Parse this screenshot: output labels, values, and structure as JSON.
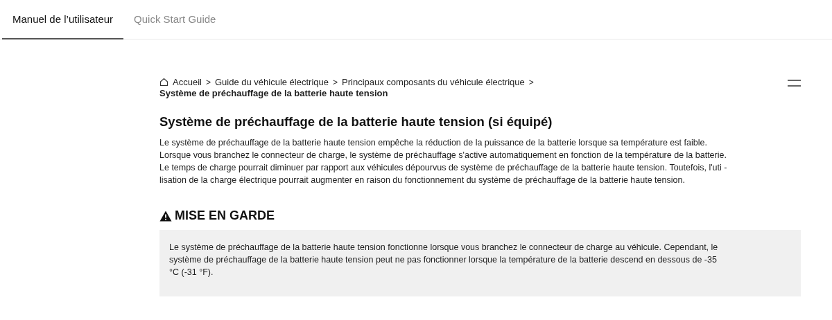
{
  "tabs": [
    {
      "label": "Manuel de l’utilisateur",
      "selected": true
    },
    {
      "label": "Quick Start Guide",
      "selected": false
    }
  ],
  "breadcrumb": {
    "items": [
      "Accueil",
      "Guide du véhicule électrique",
      "Principaux composants du véhicule électrique"
    ],
    "separator": ">",
    "current": "Système de préchauffage de la batterie haute tension"
  },
  "article": {
    "title": "Système de préchauffage de la batterie haute tension (si équipé)",
    "paragraph_lines": [
      "Le système de préchauffage de la batterie haute tension empêche la réduction de la puissance de la batterie lorsque sa température est faible.",
      "Lorsque vous branchez le connecteur de charge, le système de préchauffage s'active automatiquement en fonction de la température de la batterie.",
      "Le temps de charge pourrait diminuer par rapport aux véhicules dépourvus de système de préchauffage de la batterie haute tension. Toutefois, l'uti -",
      "lisation de la charge électrique pourrait augmenter en raison du fonctionnement du système de préchauffage de la batterie haute tension."
    ],
    "caution": {
      "title": "MISE EN GARDE",
      "lines": [
        "Le système de préchauffage de la batterie haute tension fonctionne lorsque vous branchez le connecteur de charge au véhicule. Cependant, le",
        "système de préchauffage de la batterie haute tension peut ne pas fonctionner lorsque la température de la batterie descend en dessous de -35",
        "°C (-31 °F)."
      ]
    }
  }
}
